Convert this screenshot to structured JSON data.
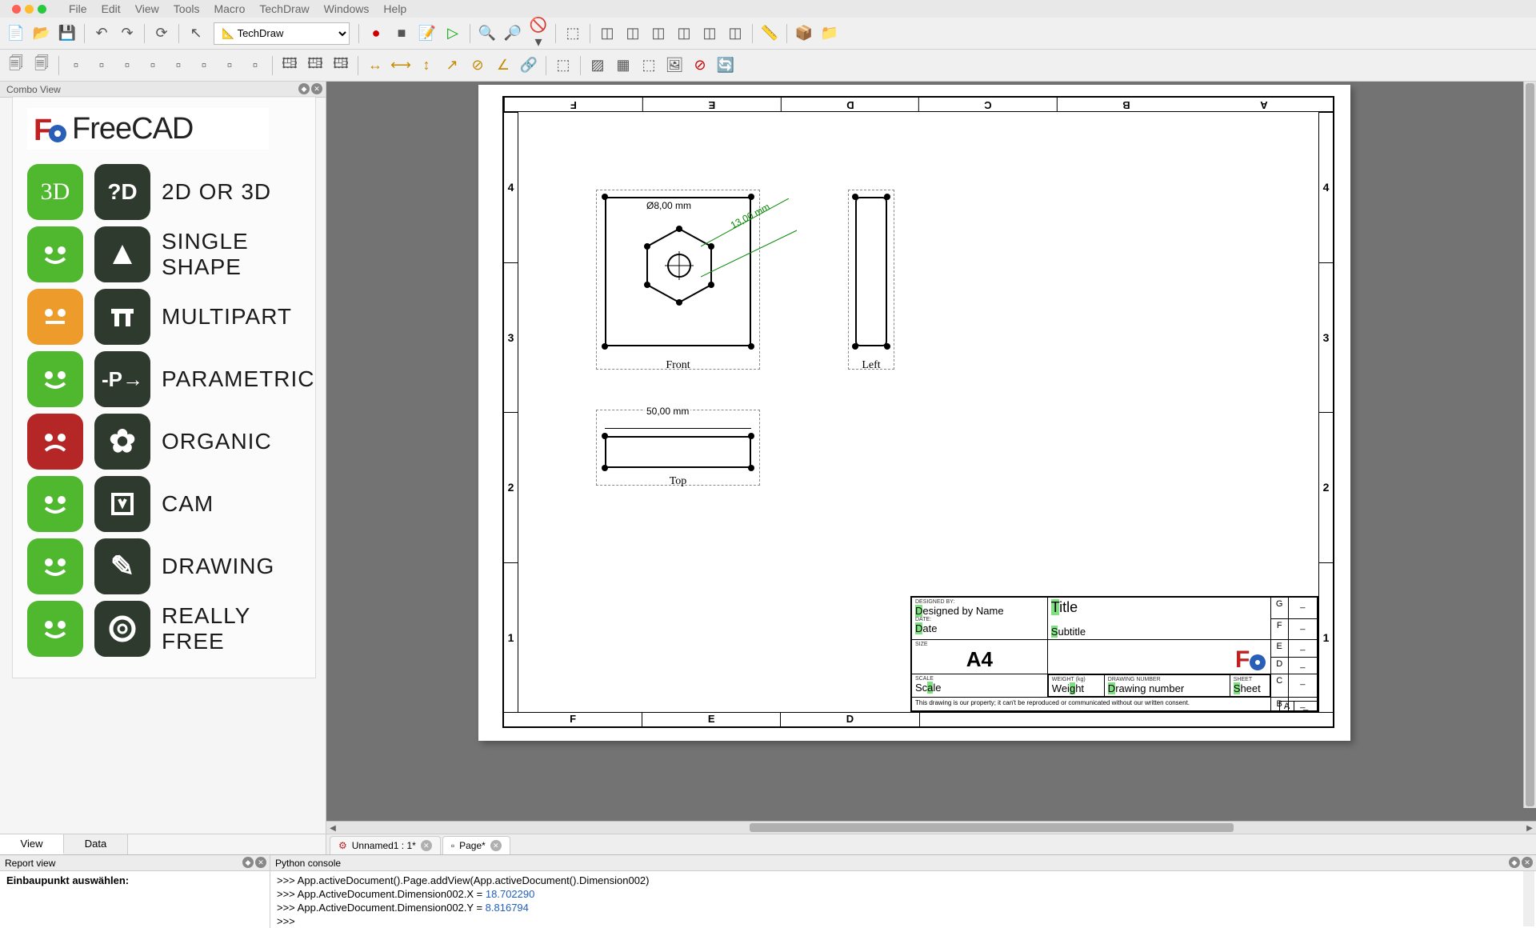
{
  "menu": {
    "items": [
      "File",
      "Edit",
      "View",
      "Tools",
      "Macro",
      "TechDraw",
      "Windows",
      "Help"
    ]
  },
  "workbench": {
    "selected": "TechDraw"
  },
  "combo": {
    "title": "Combo View"
  },
  "viewtabs": {
    "view": "View",
    "data": "Data"
  },
  "logo": {
    "brand": "FreeCAD"
  },
  "features": [
    {
      "face": "green",
      "icon": "3D",
      "label": "2D OR 3D"
    },
    {
      "face": "green",
      "icon": "▲",
      "label": "SINGLE SHAPE"
    },
    {
      "face": "orange",
      "icon": "⬓",
      "label": "MULTIPART"
    },
    {
      "face": "green",
      "icon": "P→",
      "label": "PARAMETRIC"
    },
    {
      "face": "red",
      "icon": "✿",
      "label": "ORGANIC"
    },
    {
      "face": "green",
      "icon": "⬇",
      "label": "CAM"
    },
    {
      "face": "green",
      "icon": "✎",
      "label": "DRAWING"
    },
    {
      "face": "green",
      "icon": "◯",
      "label": "REALLY FREE"
    }
  ],
  "sheet": {
    "cols": [
      "F",
      "E",
      "D",
      "C",
      "B",
      "A"
    ],
    "rows": [
      "1",
      "2",
      "3",
      "4"
    ],
    "views": {
      "front": "Front",
      "left": "Left",
      "top": "Top"
    },
    "dims": {
      "width": "50,00  mm",
      "diameter": "Ø8,00  mm",
      "diag": "13,00  mm"
    }
  },
  "titleblock": {
    "designed_by_lbl": "DESIGNED BY:",
    "designed_by": "Designed by Name",
    "date_lbl": "DATE:",
    "date": "Date",
    "size_lbl": "SIZE",
    "size": "A4",
    "title": "Title",
    "subtitle": "Subtitle",
    "scale_lbl": "SCALE",
    "scale": "Scale",
    "weight_lbl": "WEIGHT (kg)",
    "weight": "Weight",
    "drawnum_lbl": "DRAWING NUMBER",
    "drawnum": "Drawing number",
    "sheet_lbl": "SHEET",
    "sheet": "Sheet",
    "rev_letters": [
      "G",
      "F",
      "E",
      "D",
      "C",
      "B",
      "A"
    ],
    "footer": "This drawing is our property; it can't be reproduced or communicated without our written consent."
  },
  "doctabs": {
    "t1": "Unnamed1 : 1*",
    "t2": "Page*"
  },
  "report": {
    "title": "Report view",
    "line1": "Einbaupunkt auswählen:"
  },
  "py": {
    "title": "Python console",
    "l1a": ">>>  App.activeDocument().Page.addView(App.activeDocument().Dimension002)",
    "l2a": ">>>  App.ActiveDocument.Dimension002.X = ",
    "l2b": "18.702290",
    "l3a": ">>>  App.ActiveDocument.Dimension002.Y = ",
    "l3b": "8.816794",
    "l4": ">>>"
  }
}
